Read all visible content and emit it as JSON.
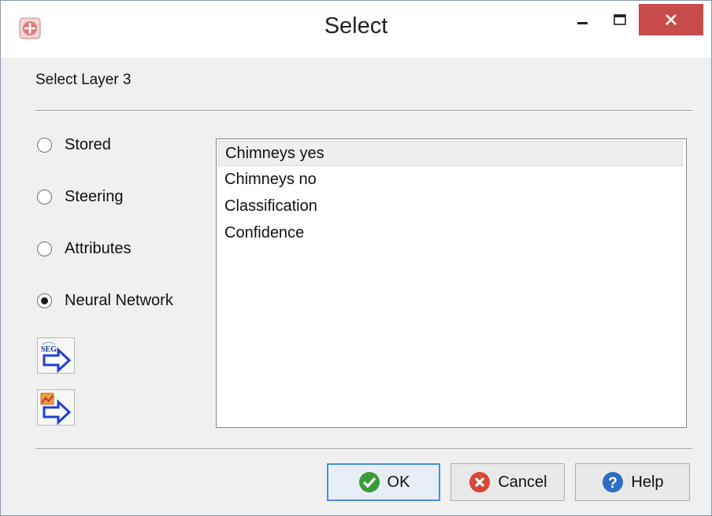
{
  "window": {
    "title": "Select",
    "app_icon": "app-logo-icon",
    "controls": {
      "minimize": "minimize-icon",
      "maximize": "maximize-icon",
      "close": "close-icon"
    }
  },
  "dialog": {
    "heading": "Select Layer 3",
    "sources": [
      {
        "label": "Stored",
        "selected": false
      },
      {
        "label": "Steering",
        "selected": false
      },
      {
        "label": "Attributes",
        "selected": false
      },
      {
        "label": "Neural Network",
        "selected": true
      }
    ],
    "tools": [
      {
        "icon": "import-seg-icon"
      },
      {
        "icon": "import-file-icon"
      }
    ],
    "list": {
      "items": [
        "Chimneys yes",
        "Chimneys no",
        "Classification",
        "Confidence"
      ],
      "selected_index": 0
    }
  },
  "buttons": {
    "ok": "OK",
    "cancel": "Cancel",
    "help": "Help"
  },
  "colors": {
    "close_bg": "#c94b4b",
    "ok_icon": "#3a9b3a",
    "cancel_icon": "#d9473a",
    "help_icon": "#2e6fc4",
    "ok_border": "#4a90d9"
  }
}
